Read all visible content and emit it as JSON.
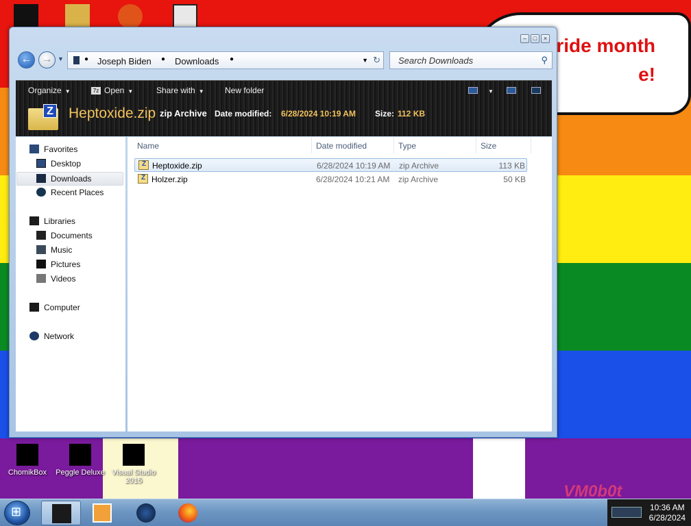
{
  "desktop": {
    "bubble_text": "ride month\ne!",
    "icons": [
      {
        "label": "ChomikBox"
      },
      {
        "label": "Peggle Deluxe"
      },
      {
        "label": "Visual Studio 2015"
      }
    ],
    "watermark": "VM0b0t"
  },
  "window": {
    "breadcrumbs": [
      "Joseph Biden",
      "Downloads"
    ],
    "search_placeholder": "Search Downloads",
    "toolbar": {
      "organize": "Organize",
      "open": "Open",
      "share_with": "Share with",
      "new_folder": "New folder"
    },
    "details": {
      "name": "Heptoxide.zip",
      "type": "zip Archive",
      "date_label": "Date modified:",
      "date_value": "6/28/2024 10:19 AM",
      "size_label": "Size:",
      "size_value": "112 KB"
    },
    "nav": {
      "favorites": "Favorites",
      "desktop": "Desktop",
      "downloads": "Downloads",
      "recent": "Recent Places",
      "libraries": "Libraries",
      "documents": "Documents",
      "music": "Music",
      "pictures": "Pictures",
      "videos": "Videos",
      "computer": "Computer",
      "network": "Network"
    },
    "columns": {
      "name": "Name",
      "date": "Date modified",
      "type": "Type",
      "size": "Size"
    },
    "files": [
      {
        "name": "Heptoxide.zip",
        "date": "6/28/2024 10:19 AM",
        "type": "zip Archive",
        "size": "113 KB"
      },
      {
        "name": "Holzer.zip",
        "date": "6/28/2024 10:21 AM",
        "type": "zip Archive",
        "size": "50 KB"
      }
    ]
  },
  "taskbar": {
    "time": "10:36 AM",
    "date": "6/28/2024"
  },
  "colors": {
    "accent_dark_pane": "#1c1c1c",
    "detail_highlight": "#f2c25c",
    "selection": "#dfeaf7"
  }
}
